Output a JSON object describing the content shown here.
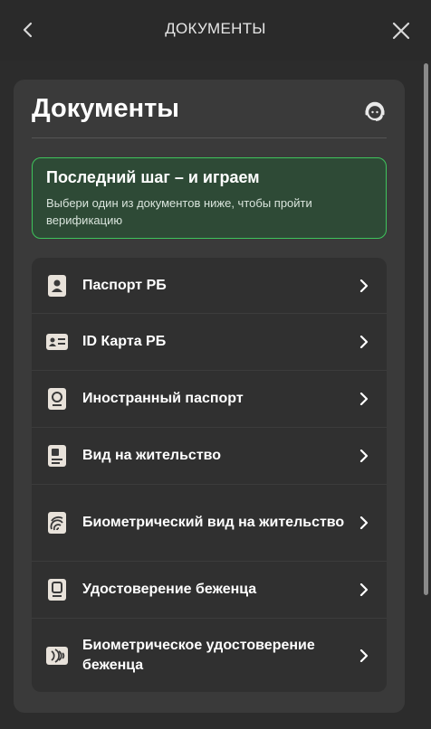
{
  "header": {
    "title": "ДОКУМЕНТЫ",
    "back_icon": "chevron-left-icon",
    "close_icon": "close-icon"
  },
  "panel": {
    "title": "Документы",
    "support_icon": "support-agent-icon"
  },
  "notice": {
    "title": "Последний шаг – и играем",
    "text": "Выбери один из документов ниже, чтобы пройти верификацию",
    "accent_color": "#3ec45c"
  },
  "documents": [
    {
      "label": "Паспорт РБ",
      "icon": "passport-icon"
    },
    {
      "label": "ID Карта РБ",
      "icon": "id-card-icon"
    },
    {
      "label": "Иностранный паспорт",
      "icon": "foreign-passport-icon"
    },
    {
      "label": "Вид на жительство",
      "icon": "residence-permit-icon"
    },
    {
      "label": "Биометрический вид на жительство",
      "icon": "biometric-permit-icon"
    },
    {
      "label": "Удостоверение беженца",
      "icon": "refugee-certificate-icon"
    },
    {
      "label": "Биометрическое удостоверение беженца",
      "icon": "biometric-refugee-icon"
    }
  ]
}
